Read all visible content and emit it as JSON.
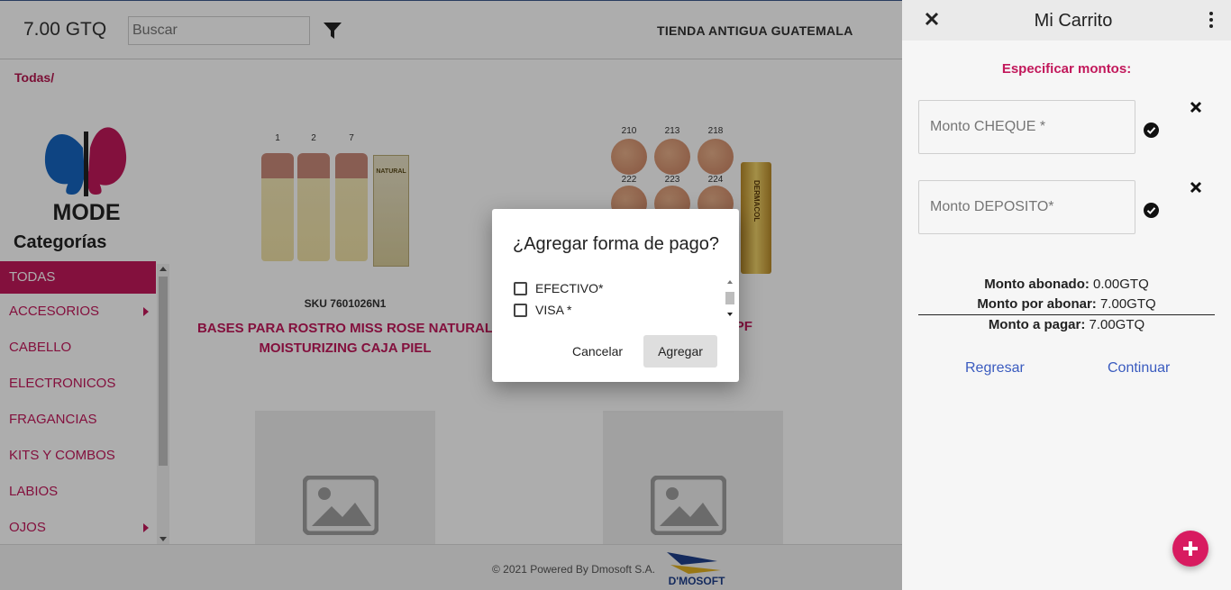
{
  "header": {
    "price": "7.00 GTQ",
    "search_placeholder": "Buscar",
    "store_name": "TIENDA ANTIGUA GUATEMALA"
  },
  "breadcrumb": "Todas/",
  "logo_text": "MODE",
  "categories": {
    "title": "Categorías",
    "items": [
      {
        "label": "TODAS",
        "active": true
      },
      {
        "label": "ACCESORIOS",
        "has_submenu": true
      },
      {
        "label": "CABELLO"
      },
      {
        "label": "ELECTRONICOS"
      },
      {
        "label": "FRAGANCIAS"
      },
      {
        "label": "KITS Y COMBOS"
      },
      {
        "label": "LABIOS"
      },
      {
        "label": "OJOS",
        "has_submenu": true
      }
    ]
  },
  "products": [
    {
      "sku": "SKU 7601026N1",
      "name_line1": "BASES PARA ROSTRO MISS ROSE NATURAL",
      "name_line2": "MOISTURIZING CAJA PIEL",
      "bottle_numbers": [
        "1",
        "2",
        "7"
      ],
      "box_text": "NATURAL"
    },
    {
      "name_visible": "RMACOL SPF",
      "swatch_labels": [
        "210",
        "213",
        "218",
        "222",
        "223",
        "224"
      ],
      "tube_text": "DERMACOL"
    }
  ],
  "footer": {
    "text": "© 2021 Powered By Dmosoft S.A.",
    "logo_text": "D'MOSOFT"
  },
  "dialog": {
    "title": "¿Agregar forma de pago?",
    "options": [
      "EFECTIVO*",
      "VISA *"
    ],
    "cancel_label": "Cancelar",
    "add_label": "Agregar"
  },
  "cart": {
    "title": "Mi Carrito",
    "specify_label": "Especificar montos:",
    "fields": [
      {
        "placeholder": "Monto CHEQUE *"
      },
      {
        "placeholder": "Monto DEPOSITO*"
      }
    ],
    "summary": [
      {
        "label": "Monto abonado:",
        "value": "0.00GTQ"
      },
      {
        "label": "Monto por abonar:",
        "value": "7.00GTQ"
      },
      {
        "label": "Monto a pagar:",
        "value": "7.00GTQ"
      }
    ],
    "back_label": "Regresar",
    "continue_label": "Continuar"
  },
  "colors": {
    "brand": "#c2185b",
    "link": "#3a5bbf",
    "fab": "#d81b60"
  },
  "icons": [
    "filter-icon",
    "close-icon",
    "more-vert-icon",
    "check-circle-icon",
    "remove-icon",
    "image-placeholder-icon",
    "add-icon"
  ]
}
